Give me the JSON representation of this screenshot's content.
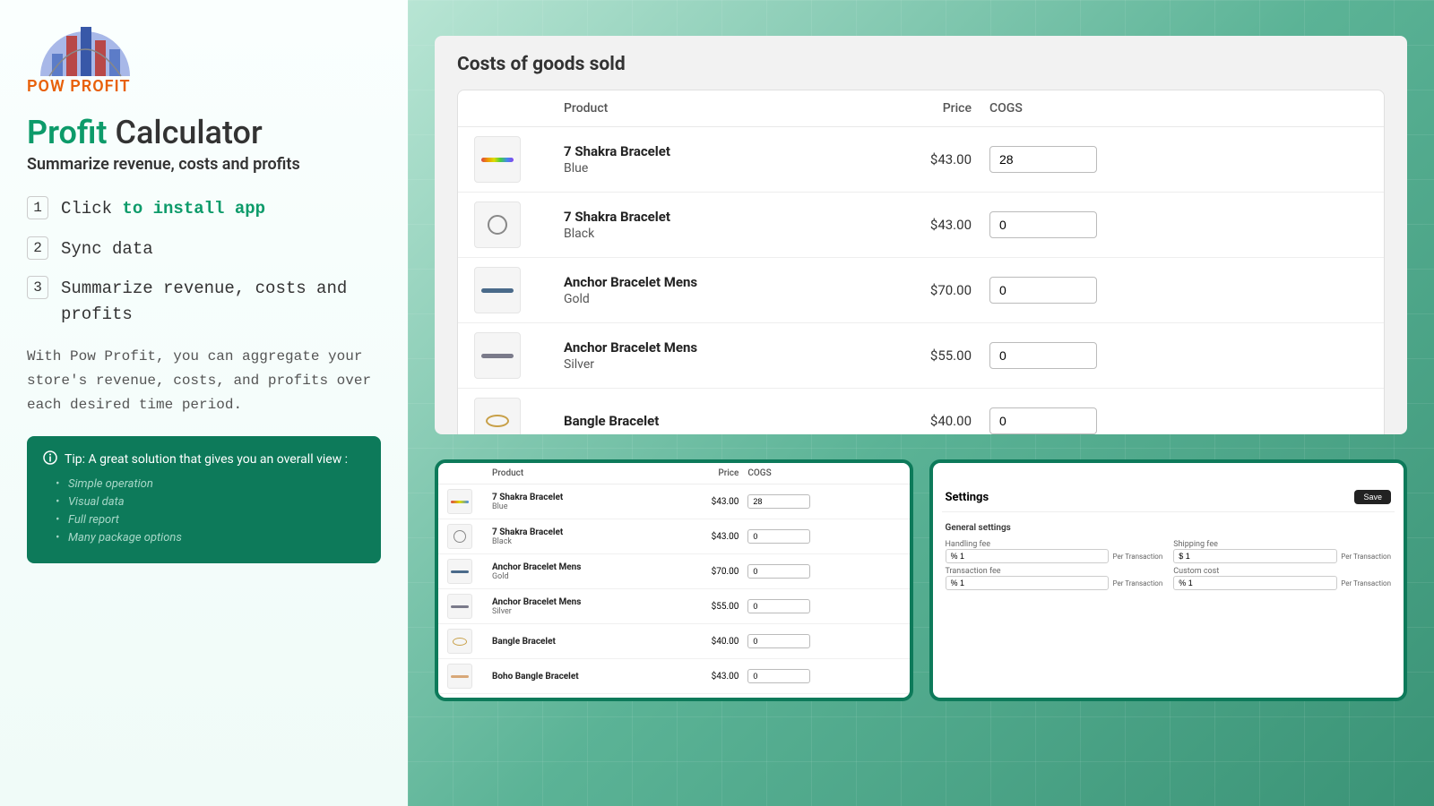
{
  "brand": {
    "name": "POW PROFIT"
  },
  "header": {
    "title_accent": "Profit",
    "title_rest": " Calculator",
    "subtitle": "Summarize revenue, costs and profits"
  },
  "steps": [
    {
      "num": "1",
      "pre": "Click ",
      "hl": "to install app",
      "post": ""
    },
    {
      "num": "2",
      "pre": "Sync data",
      "hl": "",
      "post": ""
    },
    {
      "num": "3",
      "pre": "Summarize revenue, costs and profits",
      "hl": "",
      "post": ""
    }
  ],
  "description": "With Pow Profit, you can aggregate your store's revenue, costs, and profits over each desired time period.",
  "tip": {
    "header": "Tip: A great solution that gives you an overall view :",
    "items": [
      "Simple operation",
      "Visual data",
      "Full report",
      "Many package options"
    ]
  },
  "cogs": {
    "title": "Costs of goods sold",
    "cols": {
      "product": "Product",
      "price": "Price",
      "cogs": "COGS"
    },
    "rows": [
      {
        "name": "7 Shakra Bracelet",
        "variant": "Blue",
        "price": "$43.00",
        "cogs": "28",
        "swatch": "linear-gradient(90deg,#d44,#e90,#dd0,#4c4,#48e,#84e)"
      },
      {
        "name": "7 Shakra Bracelet",
        "variant": "Black",
        "price": "$43.00",
        "cogs": "0",
        "swatch": "ring"
      },
      {
        "name": "Anchor Bracelet Mens",
        "variant": "Gold",
        "price": "$70.00",
        "cogs": "0",
        "swatch": "#4a6a8a"
      },
      {
        "name": "Anchor Bracelet Mens",
        "variant": "Silver",
        "price": "$55.00",
        "cogs": "0",
        "swatch": "#7a7a8a"
      },
      {
        "name": "Bangle Bracelet",
        "variant": "",
        "price": "$40.00",
        "cogs": "0",
        "swatch": "goldring"
      }
    ]
  },
  "thumb1": {
    "cols": {
      "product": "Product",
      "price": "Price",
      "cogs": "COGS"
    },
    "rows": [
      {
        "name": "7 Shakra Bracelet",
        "variant": "Blue",
        "price": "$43.00",
        "cogs": "28"
      },
      {
        "name": "7 Shakra Bracelet",
        "variant": "Black",
        "price": "$43.00",
        "cogs": "0"
      },
      {
        "name": "Anchor Bracelet Mens",
        "variant": "Gold",
        "price": "$70.00",
        "cogs": "0"
      },
      {
        "name": "Anchor Bracelet Mens",
        "variant": "Silver",
        "price": "$55.00",
        "cogs": "0"
      },
      {
        "name": "Bangle Bracelet",
        "variant": "",
        "price": "$40.00",
        "cogs": "0"
      },
      {
        "name": "Boho Bangle Bracelet",
        "variant": "",
        "price": "$43.00",
        "cogs": "0"
      }
    ]
  },
  "settings": {
    "title": "Settings",
    "save": "Save",
    "section": "General settings",
    "fields": [
      {
        "label": "Handling fee",
        "value": "% 1",
        "per": "Per Transaction"
      },
      {
        "label": "Shipping fee",
        "value": "$ 1",
        "per": "Per Transaction"
      },
      {
        "label": "Transaction fee",
        "value": "% 1",
        "per": "Per Transaction"
      },
      {
        "label": "Custom cost",
        "value": "% 1",
        "per": "Per Transaction"
      }
    ]
  }
}
